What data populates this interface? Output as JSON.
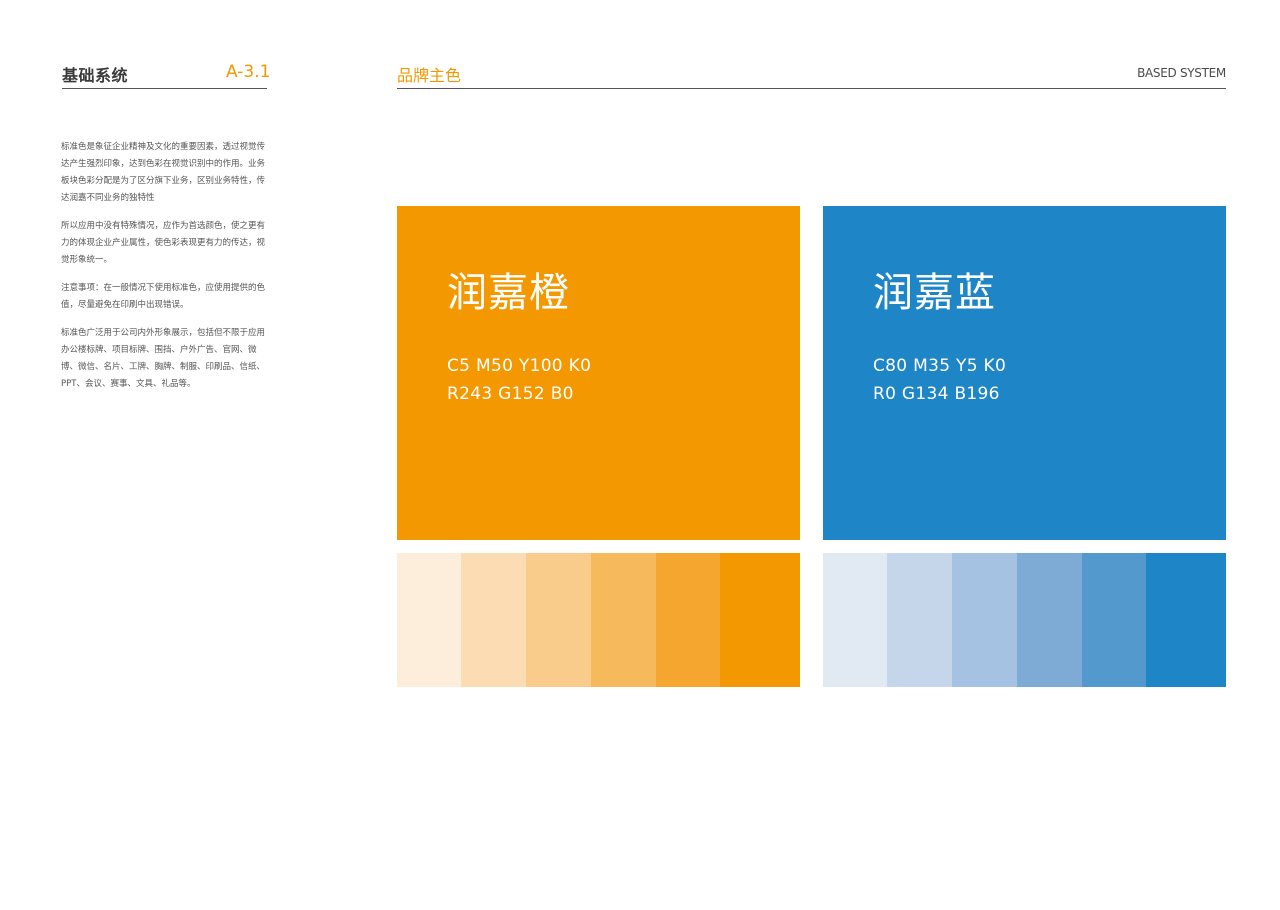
{
  "header": {
    "section_title": "基础系统",
    "section_code": "A-3.1",
    "page_title": "品牌主色",
    "page_title_en": "BASED SYSTEM"
  },
  "description": {
    "paragraphs": [
      "标准色是象征企业精神及文化的重要因素，透过视觉传达产生强烈印象，达到色彩在视觉识别中的作用。业务板块色彩分配是为了区分旗下业务，区别业务特性，传达润嘉不同业务的独特性",
      "所以应用中没有特殊情况，应作为首选颜色，使之更有力的体现企业产业属性，使色彩表现更有力的传达，视觉形象统一。",
      "注意事项：在一般情况下使用标准色，应使用提供的色值，尽量避免在印刷中出现错误。",
      "标准色广泛用于公司内外形象展示，包括但不限于应用办公楼标牌、项目标牌、围挡、户外广告、官网、微博、微信、名片、工牌、胸牌、制服、印刷品、信纸、PPT、会议、赛事、文具、礼品等。"
    ]
  },
  "colors": {
    "orange": {
      "name": "润嘉橙",
      "cmyk": "C5  M50  Y100  K0",
      "rgb": "R243  G152  B0",
      "hex": "#f39800",
      "tints": [
        "#fdeedb",
        "#fcdcb3",
        "#f9cc8c",
        "#f6b95c",
        "#f4a62e",
        "#f39800"
      ]
    },
    "blue": {
      "name": "润嘉蓝",
      "cmyk": "C80  M35  Y5  K0",
      "rgb": "R0  G134  B196",
      "hex": "#1e86c6",
      "tints": [
        "#e1e9f3",
        "#c6d6ea",
        "#a5c2e3",
        "#7eaad6",
        "#5499cd",
        "#1e86c6"
      ]
    }
  }
}
